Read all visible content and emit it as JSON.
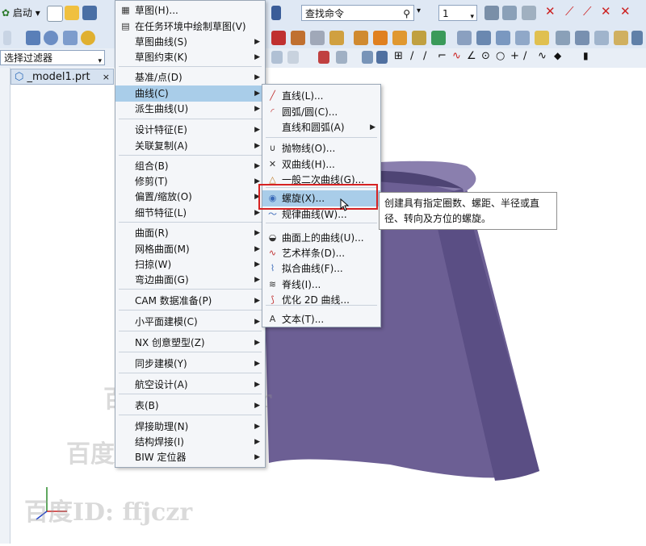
{
  "toolbar": {
    "start_label": "启动",
    "command_finder": "查找命令",
    "layer_value": "1"
  },
  "selection": {
    "filter_label": "选择过滤器"
  },
  "tab": {
    "title": "_model1.prt",
    "close": "×"
  },
  "insert_menu": {
    "items": [
      {
        "label": "草图(H)...",
        "icon": "sketch-icon"
      },
      {
        "label": "在任务环境中绘制草图(V)",
        "icon": "sketch-task-icon"
      },
      {
        "label": "草图曲线(S)",
        "submenu": true
      },
      {
        "label": "草图约束(K)",
        "submenu": true
      },
      {
        "label": "基准/点(D)",
        "submenu": true
      },
      {
        "label": "曲线(C)",
        "submenu": true,
        "highlighted": true
      },
      {
        "label": "派生曲线(U)",
        "submenu": true
      },
      {
        "label": "设计特征(E)",
        "submenu": true
      },
      {
        "label": "关联复制(A)",
        "submenu": true
      },
      {
        "label": "组合(B)",
        "submenu": true
      },
      {
        "label": "修剪(T)",
        "submenu": true
      },
      {
        "label": "偏置/缩放(O)",
        "submenu": true
      },
      {
        "label": "细节特征(L)",
        "submenu": true
      },
      {
        "label": "曲面(R)",
        "submenu": true
      },
      {
        "label": "网格曲面(M)",
        "submenu": true
      },
      {
        "label": "扫掠(W)",
        "submenu": true
      },
      {
        "label": "弯边曲面(G)",
        "submenu": true
      },
      {
        "label": "CAM 数据准备(P)",
        "submenu": true
      },
      {
        "label": "小平面建模(C)",
        "submenu": true
      },
      {
        "label": "NX 创意塑型(Z)",
        "submenu": true
      },
      {
        "label": "同步建模(Y)",
        "submenu": true
      },
      {
        "label": "航空设计(A)",
        "submenu": true
      },
      {
        "label": "表(B)",
        "submenu": true
      },
      {
        "label": "焊接助理(N)",
        "submenu": true
      },
      {
        "label": "结构焊接(I)",
        "submenu": true
      },
      {
        "label": "BIW 定位器",
        "submenu": true
      }
    ]
  },
  "curve_menu": {
    "items": [
      {
        "label": "直线(L)...",
        "icon": "line-icon"
      },
      {
        "label": "圆弧/圆(C)...",
        "icon": "arc-icon"
      },
      {
        "label": "直线和圆弧(A)",
        "submenu": true
      },
      {
        "label": "抛物线(O)...",
        "icon": "parabola-icon"
      },
      {
        "label": "双曲线(H)...",
        "icon": "hyperbola-icon"
      },
      {
        "label": "一般二次曲线(G)...",
        "icon": "conic-icon"
      },
      {
        "label": "螺旋(X)...",
        "icon": "helix-icon",
        "highlighted": true
      },
      {
        "label": "规律曲线(W)...",
        "icon": "law-curve-icon"
      },
      {
        "label": "曲面上的曲线(U)...",
        "icon": "curve-on-surface-icon"
      },
      {
        "label": "艺术样条(D)...",
        "icon": "spline-icon"
      },
      {
        "label": "拟合曲线(F)...",
        "icon": "fit-curve-icon"
      },
      {
        "label": "脊线(I)...",
        "icon": "spine-icon"
      },
      {
        "label": "优化 2D 曲线...",
        "icon": "optimize-curve-icon"
      },
      {
        "label": "文本(T)...",
        "icon": "text-icon"
      }
    ]
  },
  "tooltip": {
    "line1": "创建具有指定圈数、螺距、半径或直",
    "line2": "径、转向及方位的螺旋。"
  },
  "watermark": "百度ID: ffjczr",
  "colors": {
    "model": "#6c5f94",
    "highlight": "#a9cde9",
    "callout": "#d62222"
  }
}
